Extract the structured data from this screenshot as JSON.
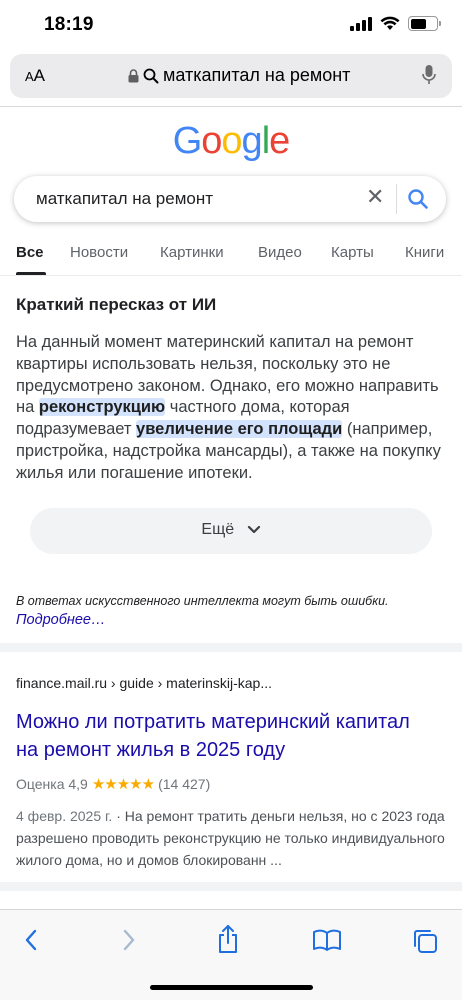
{
  "status": {
    "time": "18:19"
  },
  "address_bar": {
    "text_size_label_small": "A",
    "text_size_label_large": "A",
    "url_text": "маткапитал на ремонт"
  },
  "google": {
    "logo_letters": [
      {
        "ch": "G",
        "color": "#4285F4"
      },
      {
        "ch": "o",
        "color": "#EA4335"
      },
      {
        "ch": "o",
        "color": "#FBBC05"
      },
      {
        "ch": "g",
        "color": "#4285F4"
      },
      {
        "ch": "l",
        "color": "#34A853"
      },
      {
        "ch": "e",
        "color": "#EA4335"
      }
    ]
  },
  "search": {
    "query": "маткапитал на ремонт",
    "clear_glyph": "✕"
  },
  "tabs": [
    {
      "label": "Все",
      "active": true
    },
    {
      "label": "Новости",
      "active": false
    },
    {
      "label": "Картинки",
      "active": false
    },
    {
      "label": "Видео",
      "active": false
    },
    {
      "label": "Карты",
      "active": false
    },
    {
      "label": "Книги",
      "active": false
    }
  ],
  "ai_overview": {
    "title": "Краткий пересказ от ИИ",
    "p1": "На данный момент материнский капитал на ремонт квартиры использовать нельзя, поскольку это не предусмотрено законом. Однако, его можно направить на ",
    "hl1": "реконструкцию",
    "p2": " частного дома, которая подразумевает ",
    "hl2": "увеличение его площади",
    "p3": " (например, пристройка, надстройка мансарды), а также на покупку жилья или погашение ипотеки.",
    "more_label": "Ещё",
    "disclaimer": "В ответах искусственного интеллекта могут быть ошибки.",
    "learn_more": "Подробнее…"
  },
  "result": {
    "breadcrumb": "finance.mail.ru › guide › materinskij-kap...",
    "title": "Можно ли потратить материнский капитал на ремонт жилья в 2025 году",
    "rating_label": "Оценка 4,9",
    "stars": "★★★★★",
    "rating_count": "(14 427)",
    "date": "4 февр. 2025 г.",
    "snippet": " · На ремонт тратить деньги нельзя, но с 2023 года разрешено проводить реконструкцию не только индивидуального жилого дома, но и домов блокированн ..."
  },
  "colors": {
    "link": "#1a0dab",
    "highlight": "#d3e3fd",
    "google_blue": "#4285F4"
  }
}
